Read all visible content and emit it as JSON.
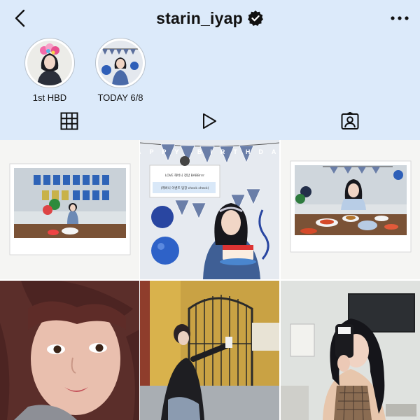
{
  "header": {
    "username": "starin_iyap",
    "verified": true,
    "back_icon": "chevron-left-icon",
    "more_icon": "more-horizontal-icon",
    "background": "#dceafa"
  },
  "highlights": [
    {
      "label": "1st HBD"
    },
    {
      "label": "TODAY 6/8"
    }
  ],
  "tabs": [
    {
      "icon": "grid-icon",
      "active": true
    },
    {
      "icon": "reels-play-icon",
      "active": false
    },
    {
      "icon": "tagged-person-icon",
      "active": false
    }
  ],
  "posts": {
    "post_2": {
      "banner": "HAPPY BIRTHDAY",
      "notice_line1": "LOVE 해버니 정답 BABBrrrr",
      "notice_line2": "(캐버니 이벤트 답장 check check)"
    }
  },
  "colors": {
    "accent_blue": "#2f5fb8",
    "text": "#111111"
  }
}
